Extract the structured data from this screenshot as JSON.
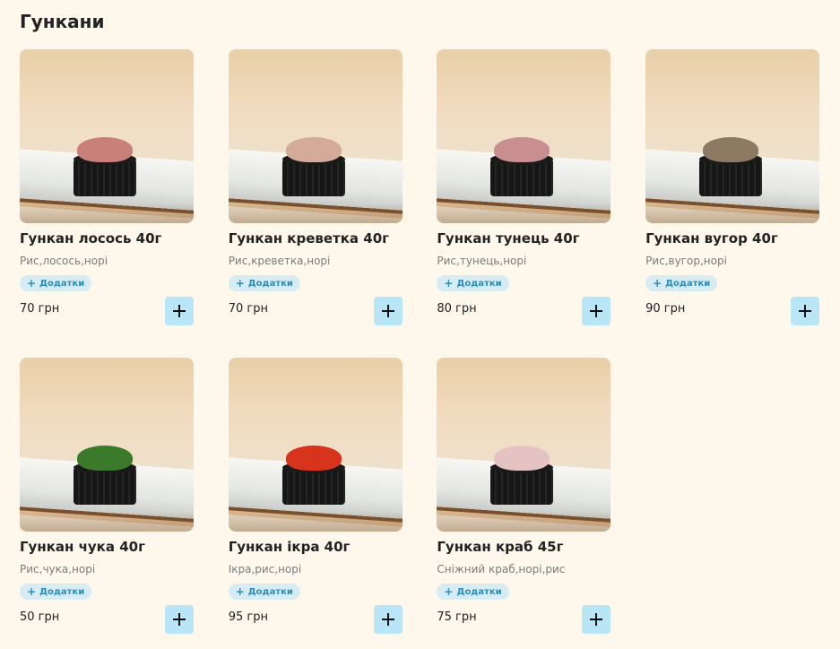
{
  "section": {
    "title": "Гункани"
  },
  "products": [
    {
      "name": "Гункан лосось 40г",
      "ingredients": "Рис,лосось,норі",
      "addons_label": "Додатки",
      "price": "70 грн",
      "topping_color": "#c97f7a"
    },
    {
      "name": "Гункан креветка 40г",
      "ingredients": "Рис,креветка,норі",
      "addons_label": "Додатки",
      "price": "70 грн",
      "topping_color": "#d4aa9a"
    },
    {
      "name": "Гункан тунець 40г",
      "ingredients": "Рис,тунець,норі",
      "addons_label": "Додатки",
      "price": "80 грн",
      "topping_color": "#c98e90"
    },
    {
      "name": "Гункан вугор 40г",
      "ingredients": "Рис,вугор,норі",
      "addons_label": "Додатки",
      "price": "90 грн",
      "topping_color": "#8c7b62"
    },
    {
      "name": "Гункан чука 40г",
      "ingredients": "Рис,чука,норі",
      "addons_label": "Додатки",
      "price": "50 грн",
      "topping_color": "#3c7a2b"
    },
    {
      "name": "Гункан ікра 40г",
      "ingredients": "Ікра,рис,норі",
      "addons_label": "Додатки",
      "price": "95 грн",
      "topping_color": "#d8331c"
    },
    {
      "name": "Гункан краб 45г",
      "ingredients": "Сніжний краб,норі,рис",
      "addons_label": "Додатки",
      "price": "75 грн",
      "topping_color": "#e6c3c3"
    }
  ],
  "icons": {
    "addons": "plus-icon",
    "add_to_cart": "plus-icon"
  },
  "colors": {
    "background": "#fdf7ec",
    "accent_light": "#b9e6f7",
    "badge_bg": "#d7ecf2",
    "badge_text": "#2f8bb8"
  }
}
